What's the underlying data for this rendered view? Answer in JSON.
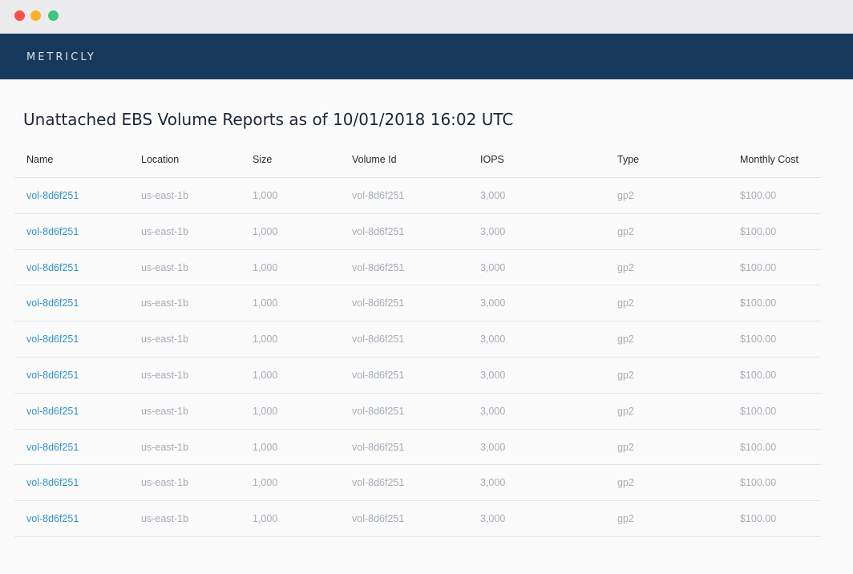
{
  "window": {
    "controls": [
      "close",
      "minimize",
      "maximize"
    ]
  },
  "navbar": {
    "brand": "METRICLY",
    "background": "#17395c"
  },
  "page": {
    "title": "Unattached EBS Volume Reports as of 10/01/2018 16:02 UTC"
  },
  "table": {
    "columns": [
      "Name",
      "Location",
      "Size",
      "Volume Id",
      "IOPS",
      "Type",
      "Monthly Cost"
    ],
    "rows": [
      [
        "vol-8d6f251",
        "us-east-1b",
        "1,000",
        "vol-8d6f251",
        "3,000",
        "gp2",
        "$100.00"
      ],
      [
        "vol-8d6f251",
        "us-east-1b",
        "1,000",
        "vol-8d6f251",
        "3,000",
        "gp2",
        "$100.00"
      ],
      [
        "vol-8d6f251",
        "us-east-1b",
        "1,000",
        "vol-8d6f251",
        "3,000",
        "gp2",
        "$100.00"
      ],
      [
        "vol-8d6f251",
        "us-east-1b",
        "1,000",
        "vol-8d6f251",
        "3,000",
        "gp2",
        "$100.00"
      ],
      [
        "vol-8d6f251",
        "us-east-1b",
        "1,000",
        "vol-8d6f251",
        "3,000",
        "gp2",
        "$100.00"
      ],
      [
        "vol-8d6f251",
        "us-east-1b",
        "1,000",
        "vol-8d6f251",
        "3,000",
        "gp2",
        "$100.00"
      ],
      [
        "vol-8d6f251",
        "us-east-1b",
        "1,000",
        "vol-8d6f251",
        "3,000",
        "gp2",
        "$100.00"
      ],
      [
        "vol-8d6f251",
        "us-east-1b",
        "1,000",
        "vol-8d6f251",
        "3,000",
        "gp2",
        "$100.00"
      ],
      [
        "vol-8d6f251",
        "us-east-1b",
        "1,000",
        "vol-8d6f251",
        "3,000",
        "gp2",
        "$100.00"
      ],
      [
        "vol-8d6f251",
        "us-east-1b",
        "1,000",
        "vol-8d6f251",
        "3,000",
        "gp2",
        "$100.00"
      ]
    ],
    "link_color": "#2f93c9"
  }
}
